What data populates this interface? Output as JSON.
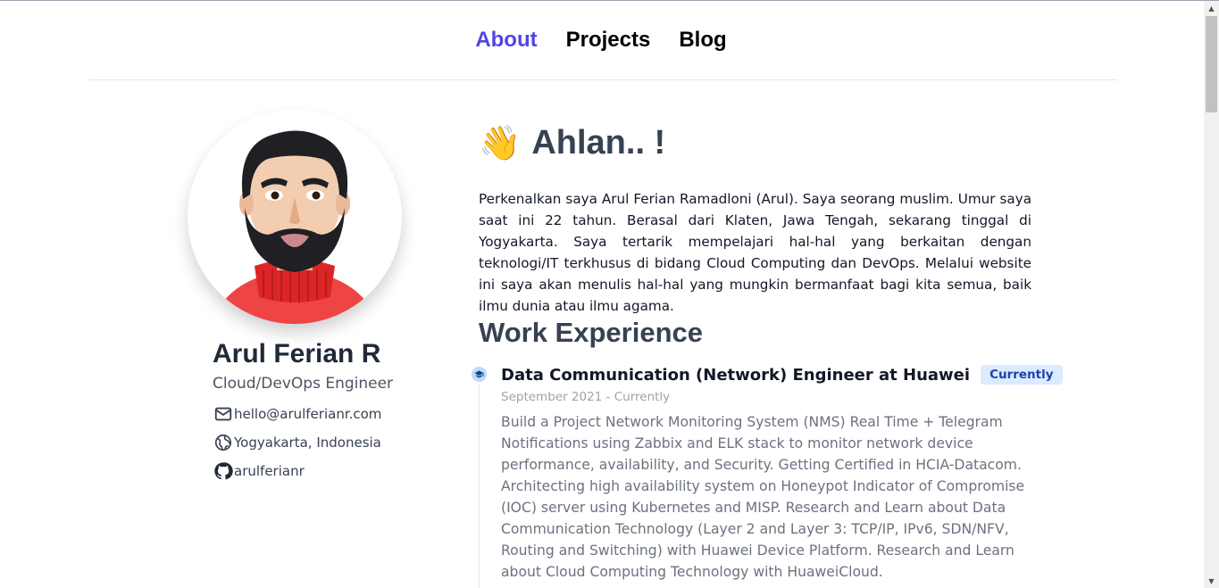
{
  "nav": {
    "items": [
      {
        "label": "About",
        "active": true
      },
      {
        "label": "Projects",
        "active": false
      },
      {
        "label": "Blog",
        "active": false
      }
    ],
    "active_color": "#4f46e5"
  },
  "profile": {
    "name": "Arul Ferian R",
    "role": "Cloud/DevOps Engineer",
    "avatar_icon": "avatar-illustration",
    "contacts": {
      "email": {
        "icon": "mail-icon",
        "value": "hello@arulferianr.com"
      },
      "location": {
        "icon": "globe-icon",
        "value": "Yogyakarta, Indonesia"
      },
      "github": {
        "icon": "github-icon",
        "value": "arulferianr"
      }
    }
  },
  "main": {
    "greeting_emoji": "👋",
    "greeting": "Ahlan.. !",
    "intro": "Perkenalkan saya Arul Ferian Ramadloni (Arul). Saya seorang muslim. Umur saya saat ini 22 tahun. Berasal dari Klaten, Jawa Tengah, sekarang tinggal di Yogyakarta. Saya tertarik mempelajari hal-hal yang berkaitan dengan teknologi/IT terkhusus di bidang Cloud Computing dan DevOps. Melalui website ini saya akan menulis hal-hal yang mungkin bermanfaat bagi kita semua, baik ilmu dunia atau ilmu agama.",
    "work_title": "Work Experience",
    "jobs": [
      {
        "title": "Data Communication (Network) Engineer at Huawei",
        "badge": "Currently",
        "dates": "September 2021 - Currently",
        "description": "Build a Project Network Monitoring System (NMS) Real Time + Telegram Notifications using Zabbix and ELK stack to monitor network device performance, availability, and Security. Getting Certified in HCIA-Datacom. Architecting high availability system on Honeypot Indicator of Compromise (IOC) server using Kubernetes and MISP. Research and Learn about Data Communication Technology (Layer 2 and Layer 3: TCP/IP, IPv6, SDN/NFV, Routing and Switching) with Huawei Device Platform. Research and Learn about Cloud Computing Technology with HuaweiCloud.",
        "icon": "graduation-cap-icon"
      }
    ]
  },
  "scrollbar": {
    "up_glyph": "▲",
    "down_glyph": "▼"
  }
}
